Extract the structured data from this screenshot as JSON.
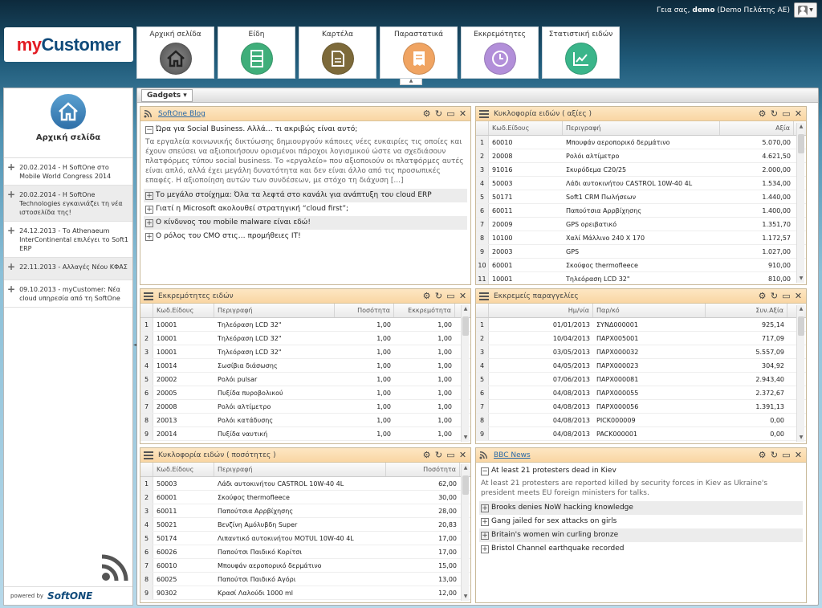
{
  "header": {
    "greeting_prefix": "Γεια σας,",
    "user": "demo",
    "company": "(Demo Πελάτης ΑΕ)"
  },
  "logo": {
    "part1": "my",
    "part2": "Customer"
  },
  "nav": [
    {
      "label": "Αρχική σελίδα",
      "icon": "home-icon",
      "color": "#4e4e4e"
    },
    {
      "label": "Είδη",
      "icon": "items-icon",
      "color": "#3fae7a"
    },
    {
      "label": "Καρτέλα",
      "icon": "document-icon",
      "color": "#7d6a3a"
    },
    {
      "label": "Παραστατικά",
      "icon": "receipt-icon",
      "color": "#f0a462"
    },
    {
      "label": "Εκκρεμότητες",
      "icon": "clock-icon",
      "color": "#b28fd9"
    },
    {
      "label": "Στατιστική ειδών",
      "icon": "chart-icon",
      "color": "#3ab58a"
    }
  ],
  "sidebar": {
    "home_title": "Αρχική σελίδα",
    "news": [
      "20.02.2014 - H SoftOne στο Mobile World Congress 2014",
      "20.02.2014 - H SoftOne Technologies εγκαινιάζει τη νέα ιστοσελίδα της!",
      "24.12.2013 - Το Athenaeum InterContinental επιλέγει το Soft1 ERP",
      "22.11.2013 - Αλλαγές Νέου ΚΦΑΣ",
      "09.10.2013 - myCustomer: Νέα cloud υπηρεσία από τη SoftOne"
    ],
    "powered_by": "powered by",
    "brand": "SoftONE"
  },
  "gadgets_label": "Gadgets",
  "blog": {
    "title": "SoftOne Blog",
    "expanded_title": "Ώρα για Social Business. Αλλά… τι ακριβώς είναι αυτό;",
    "expanded_text": "Τα εργαλεία κοινωνικής δικτύωσης δημιουργούν κάποιες νέες ευκαιρίες τις οποίες και έχουν σπεύσει να αξιοποιήσουν ορισμένοι πάροχοι λογισμικού ώστε να σχεδιάσουν πλατφόρμες τύπου social business. Το «εργαλείο» που αξιοποιούν οι πλατφόρμες αυτές είναι απλό, αλλά έχει μεγάλη δυνατότητα και δεν είναι άλλο από τις προσωπικές επαφές. Η αξιοποίηση αυτών των συνδέσεων, με στόχο τη διάχυση [...]",
    "items": [
      "Το μεγάλο στοίχημα: Όλα τα λεφτά στο κανάλι για ανάπτυξη του cloud ERP",
      "Γιατί η Microsoft ακολουθεί στρατηγική “cloud first”;",
      "Ο κίνδυνος του mobile malware είναι εδώ!",
      "Ο ρόλος του CMO στις… προμήθειες IT!"
    ]
  },
  "sales_value": {
    "title": "Κυκλοφορία ειδών ( αξίες )",
    "cols": [
      "Κωδ.Είδους",
      "Περιγραφή",
      "Αξία"
    ],
    "rows": [
      [
        "1",
        "60010",
        "Μπουφάν αεροπορικό δερμάτινο",
        "5.070,00"
      ],
      [
        "2",
        "20008",
        "Ρολόι αλτίμετρο",
        "4.621,50"
      ],
      [
        "3",
        "91016",
        "Σκυρόδεμα C20/25",
        "2.000,00"
      ],
      [
        "4",
        "50003",
        "Λάδι αυτοκινήτου CASTROL 10W-40 4L",
        "1.534,00"
      ],
      [
        "5",
        "50171",
        "Soft1 CRM Πωλήσεων",
        "1.440,00"
      ],
      [
        "6",
        "60011",
        "Παπούτσια Αρρβίχησης",
        "1.400,00"
      ],
      [
        "7",
        "20009",
        "GPS ορειβατικό",
        "1.351,70"
      ],
      [
        "8",
        "10100",
        "Χαλί Μάλλινο 240 X 170",
        "1.172,57"
      ],
      [
        "9",
        "20003",
        "GPS",
        "1.027,00"
      ],
      [
        "10",
        "60001",
        "Σκούφος thermofleece",
        "910,00"
      ],
      [
        "11",
        "10001",
        "Τηλεόραση LCD 32\"",
        "810,00"
      ]
    ]
  },
  "pending_items": {
    "title": "Εκκρεμότητες ειδών",
    "cols": [
      "Κωδ.Είδους",
      "Περιγραφή",
      "Ποσότητα",
      "Εκκρεμότητα"
    ],
    "rows": [
      [
        "1",
        "10001",
        "Τηλεόραση LCD 32\"",
        "1,00",
        "1,00"
      ],
      [
        "2",
        "10001",
        "Τηλεόραση LCD 32\"",
        "1,00",
        "1,00"
      ],
      [
        "3",
        "10001",
        "Τηλεόραση LCD 32\"",
        "1,00",
        "1,00"
      ],
      [
        "4",
        "10014",
        "Σωσίβια διάσωσης",
        "1,00",
        "1,00"
      ],
      [
        "5",
        "20002",
        "Ρολόι pulsar",
        "1,00",
        "1,00"
      ],
      [
        "6",
        "20005",
        "Πυξίδα πυροβολικού",
        "1,00",
        "1,00"
      ],
      [
        "7",
        "20008",
        "Ρολόι αλτίμετρο",
        "1,00",
        "1,00"
      ],
      [
        "8",
        "20013",
        "Ρολόι κατάδυσης",
        "1,00",
        "1,00"
      ],
      [
        "9",
        "20014",
        "Πυξίδα ναυτική",
        "1,00",
        "1,00"
      ]
    ]
  },
  "pending_orders": {
    "title": "Εκκρεμείς παραγγελίες",
    "cols": [
      "Ημ/νία",
      "Παρ/κό",
      "Συν.Αξία"
    ],
    "rows": [
      [
        "1",
        "01/01/2013",
        "ΣΥΝΔ000001",
        "925,14"
      ],
      [
        "2",
        "10/04/2013",
        "ΠΑΡΧ005001",
        "717,09"
      ],
      [
        "3",
        "03/05/2013",
        "ΠΑΡΧ000032",
        "5.557,09"
      ],
      [
        "4",
        "04/05/2013",
        "ΠΑΡΧ000023",
        "304,92"
      ],
      [
        "5",
        "07/06/2013",
        "ΠΑΡΧ000081",
        "2.943,40"
      ],
      [
        "6",
        "04/08/2013",
        "ΠΑΡΧ000055",
        "2.372,67"
      ],
      [
        "7",
        "04/08/2013",
        "ΠΑΡΧ000056",
        "1.391,13"
      ],
      [
        "8",
        "04/08/2013",
        "PICK000009",
        "0,00"
      ],
      [
        "9",
        "04/08/2013",
        "PACK000001",
        "0,00"
      ]
    ]
  },
  "sales_qty": {
    "title": "Κυκλοφορία ειδών ( ποσότητες )",
    "cols": [
      "Κωδ.Είδους",
      "Περιγραφή",
      "Ποσότητα"
    ],
    "rows": [
      [
        "1",
        "50003",
        "Λάδι αυτοκινήτου CASTROL 10W-40 4L",
        "62,00"
      ],
      [
        "2",
        "60001",
        "Σκούφος thermofleece",
        "30,00"
      ],
      [
        "3",
        "60011",
        "Παπούτσια Αρρβίχησης",
        "28,00"
      ],
      [
        "4",
        "50021",
        "Βενζίνη Αμόλυβδη Super",
        "20,83"
      ],
      [
        "5",
        "50174",
        "Λιπαντικό αυτοκινήτου MOTUL 10W-40 4L",
        "17,00"
      ],
      [
        "6",
        "60026",
        "Παπούτσι Παιδικό Κορίτσι",
        "17,00"
      ],
      [
        "7",
        "60010",
        "Μπουφάν αεροπορικό δερμάτινο",
        "15,00"
      ],
      [
        "8",
        "60025",
        "Παπούτσι Παιδικό Αγόρι",
        "13,00"
      ],
      [
        "9",
        "90302",
        "Κρασί Λαλούδι 1000 ml",
        "12,00"
      ]
    ]
  },
  "bbc": {
    "title": "BBC News",
    "expanded_title": "At least 21 protesters dead in Kiev",
    "expanded_text": "At least 21 protesters are reported killed by security forces in Kiev as Ukraine's president meets EU foreign ministers for talks.",
    "items": [
      "Brooks denies NoW hacking knowledge",
      "Gang jailed for sex attacks on girls",
      "Britain's women win curling bronze",
      "Bristol Channel earthquake recorded"
    ]
  }
}
